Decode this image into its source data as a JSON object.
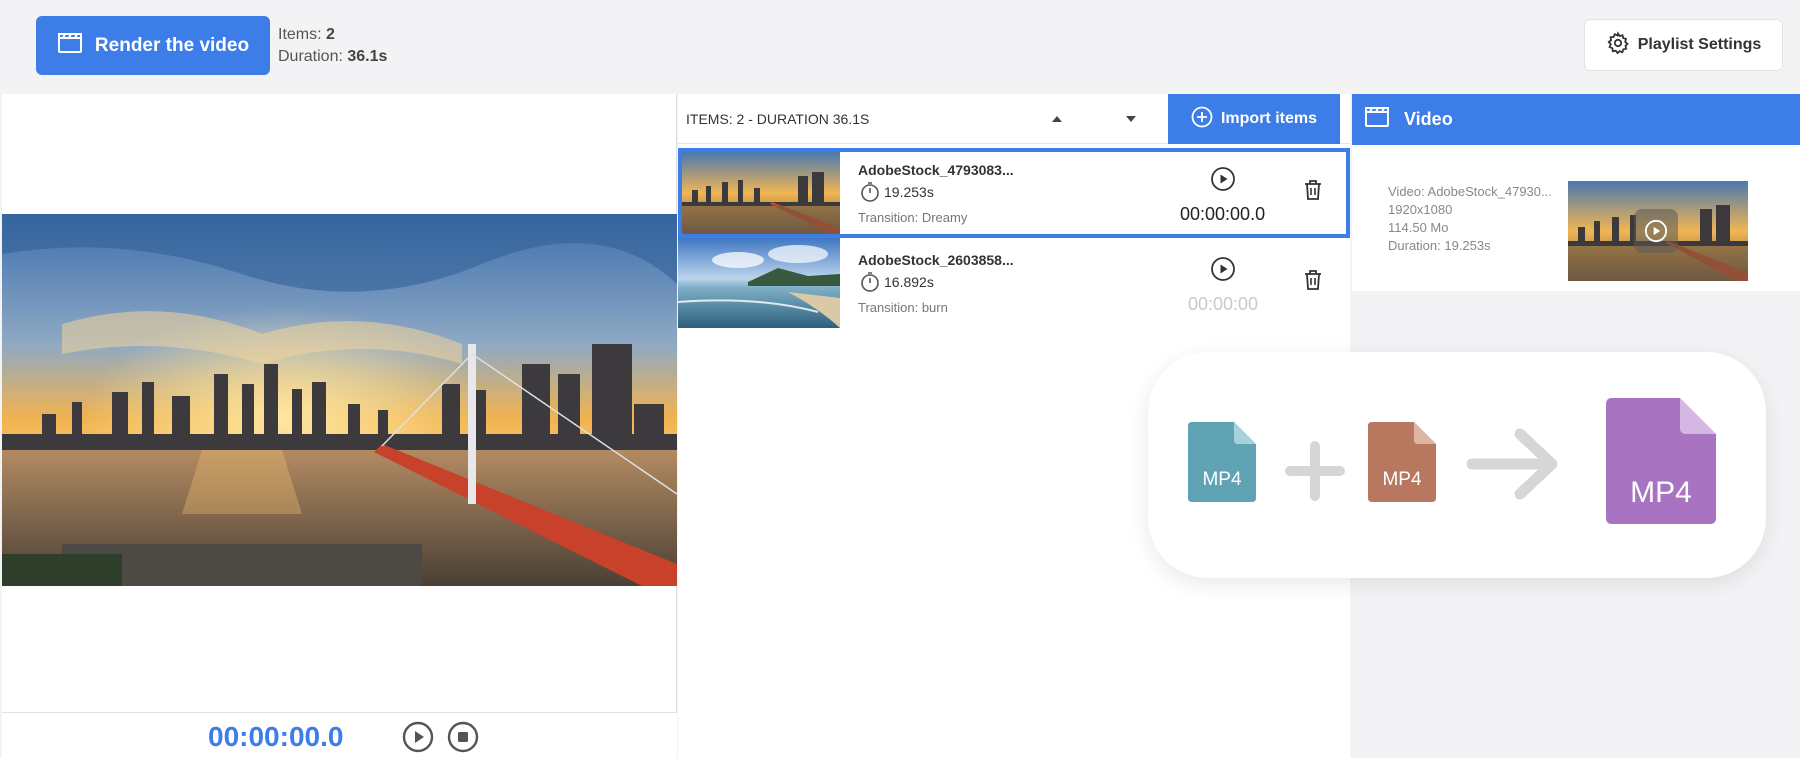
{
  "toolbar": {
    "render_label": "Render the video",
    "items_label": "Items:",
    "items_value": "2",
    "duration_label": "Duration:",
    "duration_value": "36.1s",
    "settings_label": "Playlist Settings"
  },
  "preview": {
    "timecode": "00:00:00.0"
  },
  "playlist": {
    "header": "ITEMS: 2 - DURATION 36.1S",
    "import_label": "Import items",
    "items": [
      {
        "name": "AdobeStock_4793083...",
        "duration": "19.253s",
        "transition": "Transition: Dreamy",
        "time": "00:00:00.0",
        "selected": true
      },
      {
        "name": "AdobeStock_2603858...",
        "duration": "16.892s",
        "transition": "Transition: burn",
        "time": "00:00:00",
        "selected": false
      }
    ]
  },
  "video_panel": {
    "title": "Video",
    "info_video": "Video: AdobeStock_47930...",
    "info_resolution": "1920x1080",
    "info_size": "114.50 Mo",
    "info_duration": "Duration: 19.253s"
  },
  "merge_graphic": {
    "label_1": "MP4",
    "label_2": "MP4",
    "label_result": "MP4",
    "colors": {
      "file_1": "#5fa3b5",
      "file_2": "#b8785f",
      "result": "#a874c1",
      "operator": "#d6d6d8"
    }
  },
  "colors": {
    "accent": "#3d7de8"
  }
}
